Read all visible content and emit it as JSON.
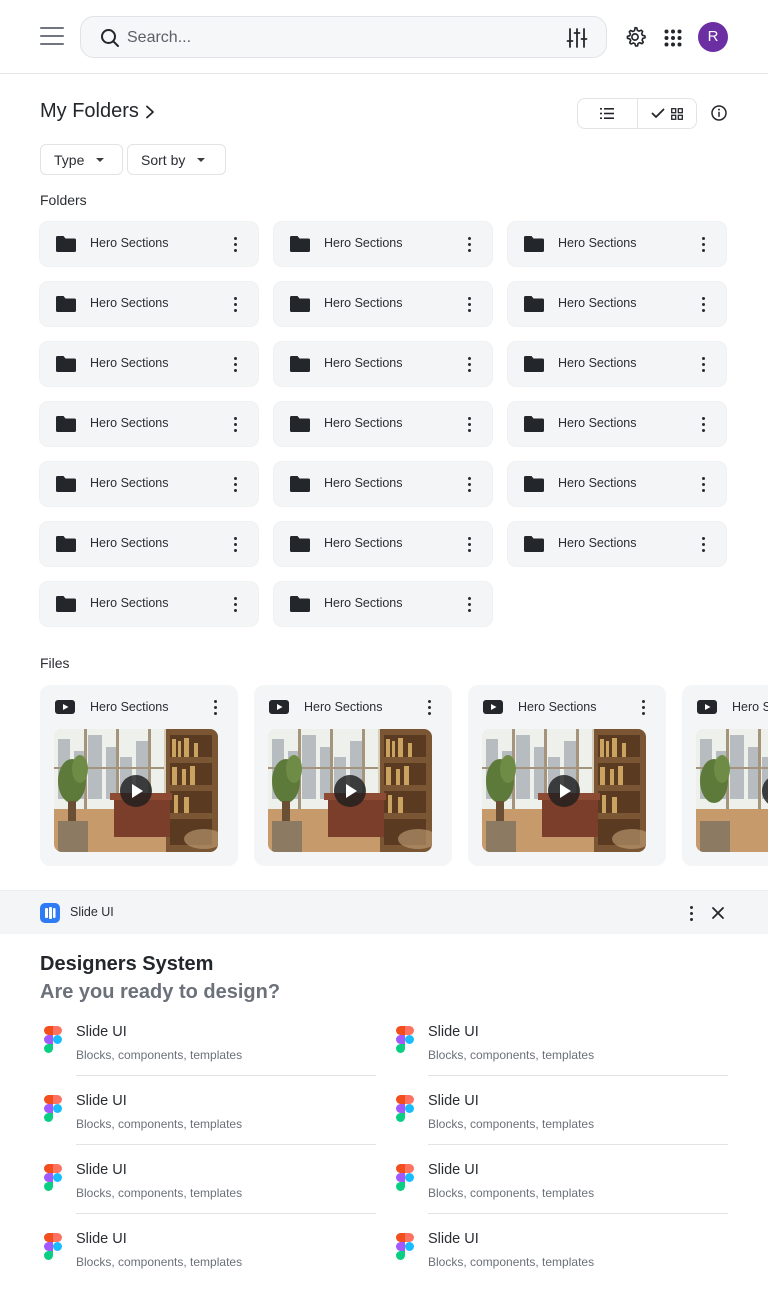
{
  "search": {
    "placeholder": "Search..."
  },
  "user": {
    "avatar_initial": "R",
    "avatar_color": "#6b2fa3"
  },
  "page": {
    "title": "My Folders"
  },
  "filters": {
    "type_label": "Type",
    "sort_label": "Sort by"
  },
  "folders": {
    "heading": "Folders",
    "items": [
      "Hero Sections",
      "Hero Sections",
      "Hero Sections",
      "Hero Sections",
      "Hero Sections",
      "Hero Sections",
      "Hero Sections",
      "Hero Sections",
      "Hero Sections",
      "Hero Sections",
      "Hero Sections",
      "Hero Sections",
      "Hero Sections",
      "Hero Sections",
      "Hero Sections",
      "Hero Sections",
      "Hero Sections",
      "Hero Sections",
      "Hero Sections",
      "Hero Sections"
    ]
  },
  "files": {
    "heading": "Files",
    "items": [
      "Hero Sections",
      "Hero Sections",
      "Hero Sections",
      "Hero Sections"
    ]
  },
  "panel": {
    "app_name": "Slide UI",
    "title": "Designers System",
    "subtitle": "Are you ready to design?",
    "resources": [
      {
        "title": "Slide UI",
        "desc": "Blocks, components, templates"
      },
      {
        "title": "Slide UI",
        "desc": "Blocks, components, templates"
      },
      {
        "title": "Slide UI",
        "desc": "Blocks, components, templates"
      },
      {
        "title": "Slide UI",
        "desc": "Blocks, components, templates"
      },
      {
        "title": "Slide UI",
        "desc": "Blocks, components, templates"
      },
      {
        "title": "Slide UI",
        "desc": "Blocks, components, templates"
      },
      {
        "title": "Slide UI",
        "desc": "Blocks, components, templates"
      },
      {
        "title": "Slide UI",
        "desc": "Blocks, components, templates"
      }
    ]
  },
  "colors": {
    "accent_blue": "#2f7bf6",
    "icon_dark": "#23262b",
    "card_bg": "#f4f5f6"
  }
}
